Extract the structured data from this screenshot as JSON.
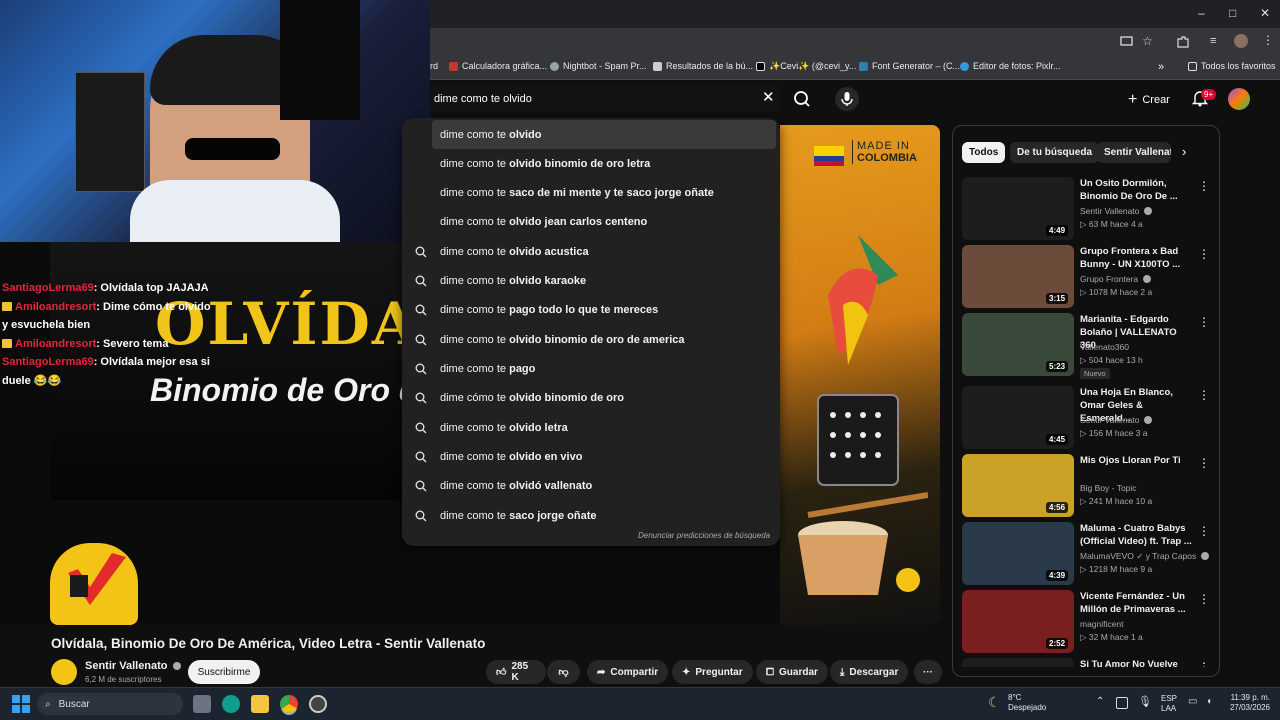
{
  "browser": {
    "bookmarks": [
      {
        "label": "rd",
        "color": "#888888"
      },
      {
        "label": "Calculadora gráfica...",
        "color": "#c0392b"
      },
      {
        "label": "Nightbot - Spam Pr...",
        "color": "#95a5a6"
      },
      {
        "label": "Resultados de la bú...",
        "color": "#cccccc"
      },
      {
        "label": "✨Cevi✨ (@cevi_y...",
        "color": "#111111"
      },
      {
        "label": "Font Generator – (C...",
        "color": "#2980b9"
      },
      {
        "label": "Editor de fotos: Pixlr...",
        "color": "#3498db"
      }
    ],
    "favorites_label": "Todos los favoritos",
    "win_controls": [
      "–",
      "□",
      "✕"
    ]
  },
  "search": {
    "query": "dime como te olvido",
    "suggestions": [
      {
        "prefix": "dime como te ",
        "bold": "olvido",
        "suffix": "",
        "icon": false
      },
      {
        "prefix": "dime como te ",
        "bold": "olvido binomio de oro letra",
        "suffix": "",
        "icon": false
      },
      {
        "prefix": "dime como te ",
        "bold": "saco de mi mente y te saco jorge oñate",
        "suffix": "",
        "icon": false
      },
      {
        "prefix": "dime como te ",
        "bold": "olvido jean carlos centeno",
        "suffix": "",
        "icon": false
      },
      {
        "prefix": "dime como te ",
        "bold": "olvido acustica",
        "suffix": "",
        "icon": true
      },
      {
        "prefix": "dime como te ",
        "bold": "olvido karaoke",
        "suffix": "",
        "icon": true
      },
      {
        "prefix": "dime como te ",
        "bold": "pago todo lo que te mereces",
        "suffix": "",
        "icon": true
      },
      {
        "prefix": "dime como te ",
        "bold": "olvido binomio de oro de america",
        "suffix": "",
        "icon": true
      },
      {
        "prefix": "dime como te ",
        "bold": "pago",
        "suffix": "",
        "icon": true
      },
      {
        "prefix": "dime cómo te ",
        "bold": "olvido binomio de oro",
        "suffix": "",
        "icon": true
      },
      {
        "prefix": "dime como te ",
        "bold": "olvido letra",
        "suffix": "",
        "icon": true
      },
      {
        "prefix": "dime como te ",
        "bold": "olvido en vivo",
        "suffix": "",
        "icon": true
      },
      {
        "prefix": "dime como te ",
        "bold": "olvidó vallenato",
        "suffix": "",
        "icon": true
      },
      {
        "prefix": "dime como te ",
        "bold": "saco jorge oñate",
        "suffix": "",
        "icon": true
      }
    ],
    "report_label": "Denunciar predicciones de búsqueda"
  },
  "masthead": {
    "create_label": "Crear",
    "notif_count": "9+"
  },
  "chat": [
    {
      "user": "SantiagoLerma69",
      "crown": false,
      "text": ": Olvídala top JAJAJA"
    },
    {
      "user": "Amiloandresort",
      "crown": true,
      "text": ": Dime cómo te olvido y esvuchela bien"
    },
    {
      "user": "Amiloandresort",
      "crown": true,
      "text": ": Severo tema"
    },
    {
      "user": "SantiagoLerma69",
      "crown": false,
      "text": ": Olvídala mejor esa si duele 😂😂"
    }
  ],
  "player": {
    "overlay_title": "OLVÍDALA",
    "overlay_subtitle": "Binomio de Oro de Am",
    "poster_made_in": "MADE IN",
    "poster_country": "COLOMBIA"
  },
  "video": {
    "title": "Olvídala, Binomio De Oro De América, Video Letra - Sentir Vallenato",
    "channel": "Sentir Vallenato",
    "subscribers": "6,2 M de suscriptores",
    "subscribe_label": "Suscribirme",
    "likes": "285 K",
    "share_label": "Compartir",
    "ask_label": "Preguntar",
    "save_label": "Guardar",
    "download_label": "Descargar"
  },
  "sidebar": {
    "chips": [
      "Todos",
      "De tu búsqueda",
      "Sentir Vallenato"
    ],
    "videos": [
      {
        "title": "Un Osito Dormilón, Binomio De Oro De ...",
        "channel": "Sentir Vallenato",
        "verified": true,
        "meta": "▷ 63 M   hace 4 a",
        "duration": "4:49",
        "new": false,
        "thumb": "#1d1d1d"
      },
      {
        "title": "Grupo Frontera x Bad Bunny - UN X100TO ...",
        "channel": "Grupo Frontera",
        "verified": true,
        "meta": "▷ 1078 M   hace 2 a",
        "duration": "3:15",
        "new": false,
        "thumb": "#6b4c3a"
      },
      {
        "title": "Marianita - Edgardo Bolaño | VALLENATO 360",
        "channel": "Vallenato360",
        "verified": false,
        "meta": "▷ 504   hace 13 h",
        "duration": "5:23",
        "new": true,
        "thumb": "#3a4a3a"
      },
      {
        "title": "Una Hoja En Blanco, Omar Geles & Esmerald...",
        "channel": "Sentir Vallenato",
        "verified": true,
        "meta": "▷ 156 M   hace 3 a",
        "duration": "4:45",
        "new": false,
        "thumb": "#1d1d1d"
      },
      {
        "title": "Mis Ojos Lloran Por Ti",
        "channel": "Big Boy - Topic",
        "verified": false,
        "meta": "▷ 241 M   hace 10 a",
        "duration": "4:56",
        "new": false,
        "thumb": "#c9a227"
      },
      {
        "title": "Maluma - Cuatro Babys (Official Video) ft. Trap ...",
        "channel": "MalumaVEVO  ✓ y Trap Capos",
        "verified": true,
        "meta": "▷ 1218 M   hace 9 a",
        "duration": "4:39",
        "new": false,
        "thumb": "#2a3a4a"
      },
      {
        "title": "Vicente Fernández - Un Millón de Primaveras ...",
        "channel": "magnificent",
        "verified": false,
        "meta": "▷ 32 M   hace 1 a",
        "duration": "2:52",
        "new": false,
        "thumb": "#7a1f1f"
      },
      {
        "title": "Si Tu Amor No Vuelve",
        "channel": "",
        "verified": false,
        "meta": "",
        "duration": "",
        "new": false,
        "thumb": "#1d1d1d"
      }
    ]
  },
  "taskbar": {
    "search_placeholder": "Buscar",
    "weather_temp": "8°C",
    "weather_desc": "Despejado",
    "lang": "ESP",
    "lang2": "LAA",
    "time": "11:39 p. m.",
    "date": "27/03/2026"
  }
}
